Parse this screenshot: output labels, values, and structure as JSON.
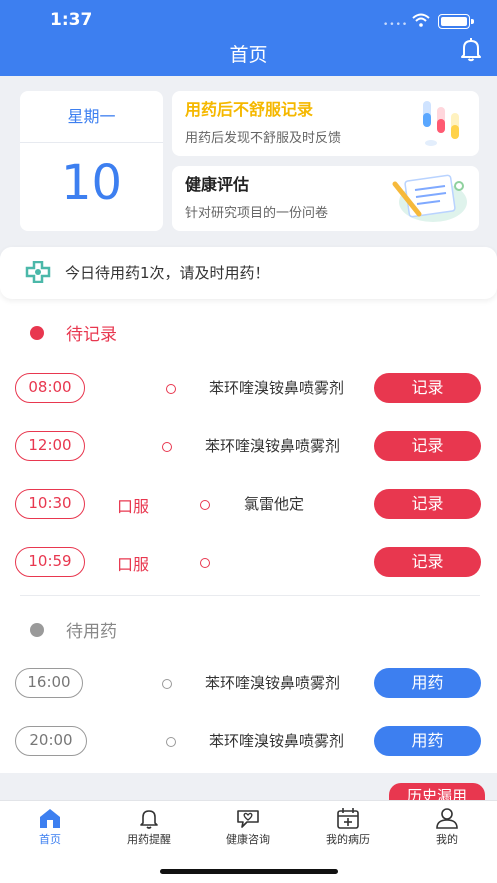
{
  "status": {
    "time": "1:37",
    "dots": "••••"
  },
  "header": {
    "title": "首页"
  },
  "date_card": {
    "weekday": "星期一",
    "day": "10"
  },
  "cards": [
    {
      "title": "用药后不舒服记录",
      "subtitle": "用药后发现不舒服及时反馈",
      "title_color": "#f5b800"
    },
    {
      "title": "健康评估",
      "subtitle": "针对研究项目的一份问卷",
      "title_color": "#222222"
    }
  ],
  "notice": {
    "text": "今日待用药1次，请及时用药！"
  },
  "pending_record": {
    "title": "待记录",
    "color": "#e8374f",
    "items": [
      {
        "time": "08:00",
        "route": "",
        "drug": "苯环喹溴铵鼻喷雾剂",
        "action": "记录"
      },
      {
        "time": "12:00",
        "route": "",
        "drug": "苯环喹溴铵鼻喷雾剂",
        "action": "记录"
      },
      {
        "time": "10:30",
        "route": "口服",
        "drug": "氯雷他定",
        "action": "记录"
      },
      {
        "time": "10:59",
        "route": "口服",
        "drug": "",
        "action": "记录"
      }
    ]
  },
  "pending_med": {
    "title": "待用药",
    "color": "#3d7ff0",
    "items": [
      {
        "time": "16:00",
        "route": "",
        "drug": "苯环喹溴铵鼻喷雾剂",
        "action": "用药"
      },
      {
        "time": "20:00",
        "route": "",
        "drug": "苯环喹溴铵鼻喷雾剂",
        "action": "用药"
      }
    ]
  },
  "history_button": "历史漏用",
  "tabs": [
    {
      "label": "首页",
      "icon": "home-icon",
      "active": true
    },
    {
      "label": "用药提醒",
      "icon": "bell-icon",
      "active": false
    },
    {
      "label": "健康咨询",
      "icon": "consult-icon",
      "active": false
    },
    {
      "label": "我的病历",
      "icon": "calendar-icon",
      "active": false
    },
    {
      "label": "我的",
      "icon": "user-icon",
      "active": false
    }
  ],
  "colors": {
    "primary": "#3d7ff0",
    "danger": "#e8374f",
    "muted": "#9a9a9a"
  }
}
